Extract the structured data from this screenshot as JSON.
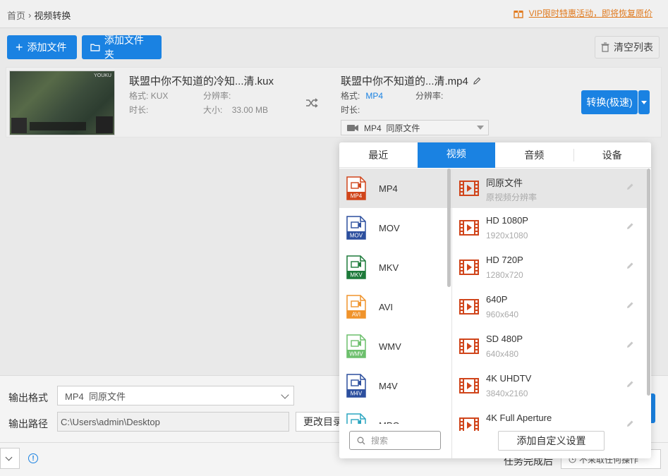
{
  "breadcrumb": {
    "home": "首页",
    "separator": "›",
    "current": "视频转换"
  },
  "promo": {
    "text": "VIP限时特惠活动，即将恢复原价",
    "icon": "gift-icon",
    "color": "#e07a1f"
  },
  "toolbar": {
    "add_file": "添加文件",
    "add_folder": "添加文件夹",
    "clear_list": "清空列表"
  },
  "file": {
    "source_name": "联盟中你不知道的冷知...清.kux",
    "format_label": "格式:",
    "format_value": "KUX",
    "resolution_label": "分辨率:",
    "duration_label": "时长:",
    "size_label": "大小:",
    "size_value": "33.00 MB",
    "thumb_watermark": "YOUKU",
    "target_name": "联盟中你不知道的...清.mp4",
    "target_format_value": "MP4",
    "target_select": "MP4  同原文件",
    "convert_button": "转换(极速)"
  },
  "popup": {
    "tabs": [
      "最近",
      "视频",
      "音频",
      "设备"
    ],
    "active_tab": "视频",
    "formats": [
      {
        "name": "MP4",
        "tag": "MP4",
        "color": "#d0451b",
        "selected": true
      },
      {
        "name": "MOV",
        "tag": "MOV",
        "color": "#2c4f9e",
        "selected": false
      },
      {
        "name": "MKV",
        "tag": "MKV",
        "color": "#1d7a3a",
        "selected": false
      },
      {
        "name": "AVI",
        "tag": "AVI",
        "color": "#f0932b",
        "selected": false
      },
      {
        "name": "WMV",
        "tag": "WMV",
        "color": "#6cbf6c",
        "selected": false
      },
      {
        "name": "M4V",
        "tag": "M4V",
        "color": "#2c4f9e",
        "selected": false
      },
      {
        "name": "MPG",
        "tag": "MPG",
        "color": "#2aa5c0",
        "selected": false
      }
    ],
    "presets": [
      {
        "name": "同原文件",
        "desc": "原视频分辨率",
        "selected": true
      },
      {
        "name": "HD 1080P",
        "desc": "1920x1080",
        "selected": false
      },
      {
        "name": "HD 720P",
        "desc": "1280x720",
        "selected": false
      },
      {
        "name": "640P",
        "desc": "960x640",
        "selected": false
      },
      {
        "name": "SD 480P",
        "desc": "640x480",
        "selected": false
      },
      {
        "name": "4K UHDTV",
        "desc": "3840x2160",
        "selected": false
      },
      {
        "name": "4K Full Aperture",
        "desc": "",
        "selected": false
      }
    ],
    "search_placeholder": "搜索",
    "add_custom": "添加自定义设置"
  },
  "bottom": {
    "output_format_label": "输出格式",
    "output_format_value": "MP4  同原文件",
    "output_path_label": "输出路径",
    "output_path_value": "C:\\Users\\admin\\Desktop",
    "change_dir": "更改目录",
    "after_task_label": "任务完成后",
    "after_task_value": "不采取任何操作"
  },
  "colors": {
    "accent": "#1a82e2",
    "preset_icon": "#d0451b"
  }
}
